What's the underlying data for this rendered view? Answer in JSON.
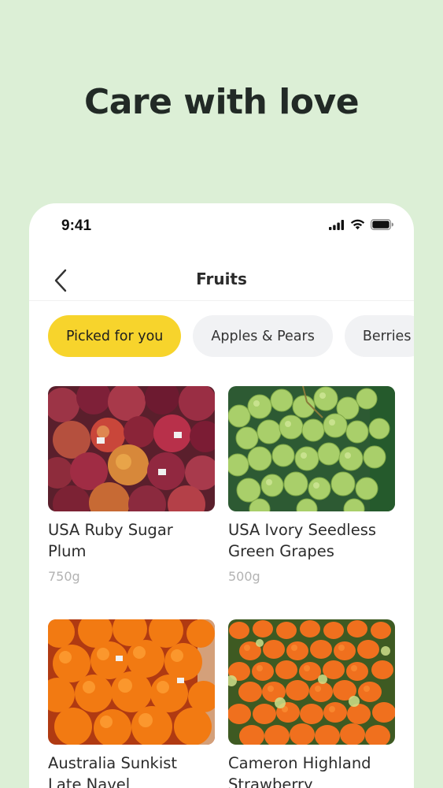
{
  "hero": {
    "title": "Care with love"
  },
  "status_bar": {
    "time": "9:41"
  },
  "nav": {
    "title": "Fruits"
  },
  "chips": [
    {
      "label": "Picked for you",
      "active": true
    },
    {
      "label": "Apples & Pears",
      "active": false
    },
    {
      "label": "Berries",
      "active": false
    }
  ],
  "products": [
    {
      "name": "USA Ruby Sugar Plum",
      "weight": "750g",
      "image": "plums"
    },
    {
      "name": "USA Ivory Seedless Green Grapes",
      "weight": "500g",
      "image": "green-grapes"
    },
    {
      "name": "Australia Sunkist Late Navel",
      "weight": "",
      "image": "oranges"
    },
    {
      "name": "Cameron Highland Strawberry",
      "weight": "",
      "image": "strawberries"
    }
  ],
  "colors": {
    "background": "#dcefd6",
    "accent_chip": "#f7d42c",
    "chip_inactive": "#f1f2f4"
  }
}
